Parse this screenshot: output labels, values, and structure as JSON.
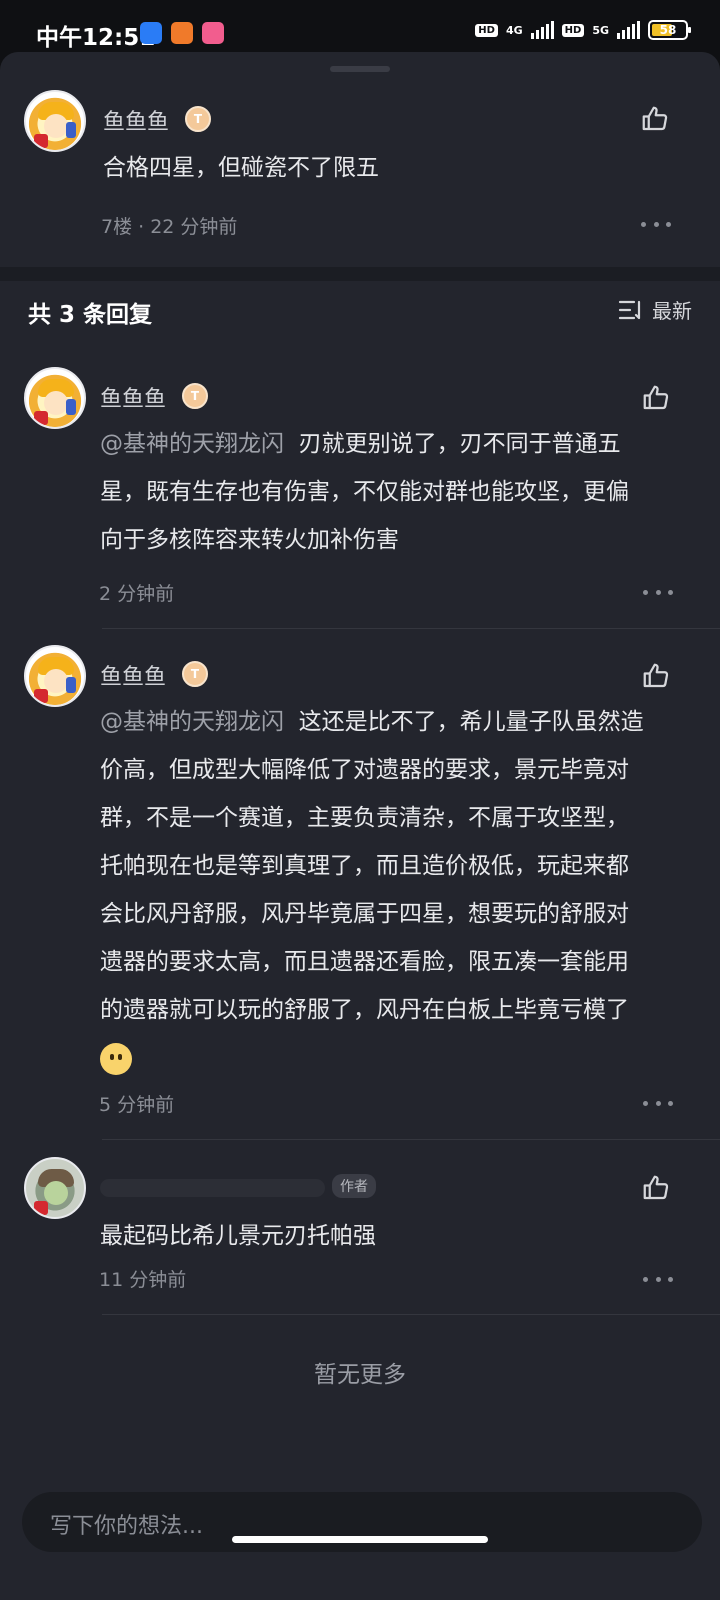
{
  "status_bar": {
    "time": "中午12:51",
    "net1": "4G",
    "net2": "5G",
    "hd": "HD",
    "battery": "58"
  },
  "main_comment": {
    "username": "鱼鱼鱼",
    "badge": "T",
    "text": "合格四星，但碰瓷不了限五",
    "meta": "7楼 · 22 分钟前"
  },
  "replies_header": {
    "count_label": "共 3 条回复",
    "sort_label": "最新"
  },
  "replies": [
    {
      "username": "鱼鱼鱼",
      "badge": "T",
      "mention": "@基神的天翔龙闪",
      "line1_rest": "刃就更别说了，刃不同于普通五",
      "lines": [
        "星，既有生存也有伤害，不仅能对群也能攻坚，更偏",
        "向于多核阵容来转火加补伤害"
      ],
      "time": "2 分钟前"
    },
    {
      "username": "鱼鱼鱼",
      "badge": "T",
      "mention": "@基神的天翔龙闪",
      "line1_rest": "这还是比不了，希儿量子队虽然造",
      "lines": [
        "价高，但成型大幅降低了对遗器的要求，景元毕竟对",
        "群，不是一个赛道，主要负责清杂，不属于攻坚型，",
        "托帕现在也是等到真理了，而且造价极低，玩起来都",
        "会比风丹舒服，风丹毕竟属于四星，想要玩的舒服对",
        "遗器的要求太高，而且遗器还看脸，限五凑一套能用",
        "的遗器就可以玩的舒服了，风丹在白板上毕竟亏模了"
      ],
      "time": "5 分钟前"
    },
    {
      "author_tag": "作者",
      "text": "最起码比希儿景元刃托帕强",
      "time": "11 分钟前"
    }
  ],
  "footer": {
    "no_more": "暂无更多",
    "input_placeholder": "写下你的想法..."
  },
  "colors": {
    "sheet_bg": "#23252d",
    "badge": "#f4c99a",
    "battery": "#f0c026"
  }
}
